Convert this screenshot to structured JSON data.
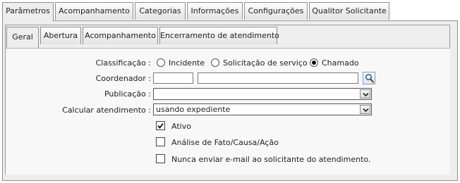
{
  "outer_tabs": [
    {
      "label": "Parâmetros",
      "active": true
    },
    {
      "label": "Acompanhamento",
      "active": false
    },
    {
      "label": "Categorias",
      "active": false
    },
    {
      "label": "Informações",
      "active": false
    },
    {
      "label": "Configurações",
      "active": false
    },
    {
      "label": "Qualitor Solicitante",
      "active": false
    }
  ],
  "inner_tabs": [
    {
      "label": "Geral",
      "active": true
    },
    {
      "label": "Abertura",
      "active": false
    },
    {
      "label": "Acompanhamento",
      "active": false
    },
    {
      "label": "Encerramento de atendimento",
      "active": false
    }
  ],
  "form": {
    "classificacao": {
      "label": "Classificação :",
      "options": [
        {
          "label": "Incidente",
          "selected": false
        },
        {
          "label": "Solicitação de serviço",
          "selected": false
        },
        {
          "label": "Chamado",
          "selected": true
        }
      ]
    },
    "coordenador": {
      "label": "Coordenador :",
      "code_value": "",
      "name_value": ""
    },
    "publicacao": {
      "label": "Publicação :",
      "value": ""
    },
    "calcular": {
      "label": "Calcular atendimento :",
      "value": "usando expediente"
    },
    "checkboxes": [
      {
        "label": "Ativo",
        "checked": true
      },
      {
        "label": "Análise de Fato/Causa/Ação",
        "checked": false
      },
      {
        "label": "Nunca enviar e-mail ao solicitante do atendimento.",
        "checked": false
      }
    ]
  },
  "icons": {
    "search": "search-icon",
    "dropdown": "chevron-down-icon",
    "check": "checkmark-icon"
  }
}
